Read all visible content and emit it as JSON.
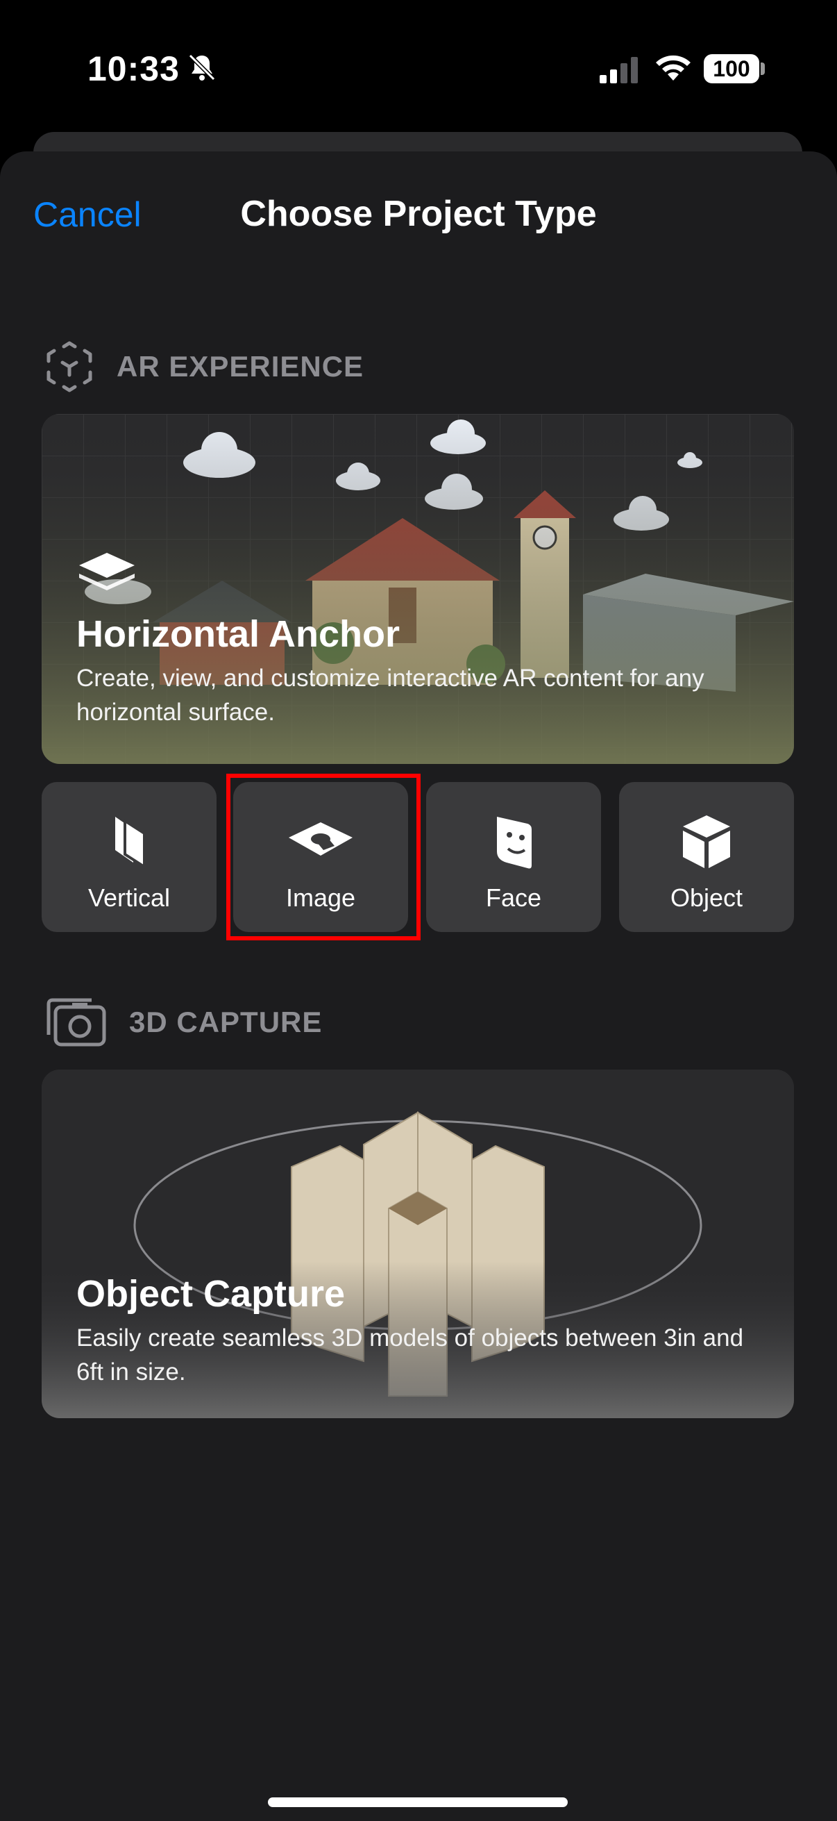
{
  "status_bar": {
    "time": "10:33",
    "battery": "100"
  },
  "header": {
    "cancel_label": "Cancel",
    "title": "Choose Project Type"
  },
  "ar_section": {
    "label": "AR EXPERIENCE",
    "hero": {
      "title": "Horizontal Anchor",
      "description": "Create, view, and customize interactive AR content for any horizontal surface."
    },
    "tiles": [
      {
        "label": "Vertical",
        "icon": "vertical-plane-icon"
      },
      {
        "label": "Image",
        "icon": "image-anchor-icon"
      },
      {
        "label": "Face",
        "icon": "face-anchor-icon"
      },
      {
        "label": "Object",
        "icon": "cube-icon"
      }
    ]
  },
  "capture_section": {
    "label": "3D CAPTURE",
    "hero": {
      "title": "Object Capture",
      "description": "Easily create seamless 3D models of objects between 3in and 6ft in size."
    }
  },
  "colors": {
    "accent": "#0a84ff",
    "highlight": "#ff0000",
    "sheet": "#1c1c1e",
    "tile": "#3a3a3c"
  }
}
